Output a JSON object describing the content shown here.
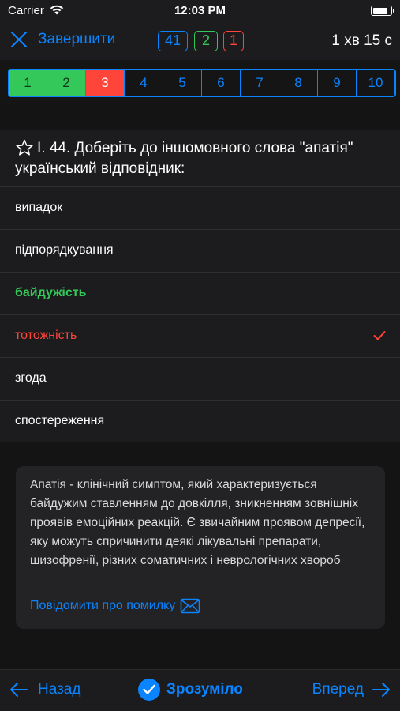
{
  "status_bar": {
    "carrier": "Carrier",
    "time": "12:03 PM",
    "battery_level": 0.85
  },
  "nav": {
    "finish_label": "Завершити",
    "counters": {
      "total": "41",
      "correct": "2",
      "wrong": "1"
    },
    "timer": "1 хв 15 с"
  },
  "question_strip": {
    "items": [
      {
        "label": "1",
        "state": "correct"
      },
      {
        "label": "2",
        "state": "correct"
      },
      {
        "label": "3",
        "state": "wrong"
      },
      {
        "label": "4",
        "state": "unanswered"
      },
      {
        "label": "5",
        "state": "unanswered"
      },
      {
        "label": "6",
        "state": "unanswered"
      },
      {
        "label": "7",
        "state": "unanswered"
      },
      {
        "label": "8",
        "state": "unanswered"
      },
      {
        "label": "9",
        "state": "unanswered"
      },
      {
        "label": "10",
        "state": "unanswered"
      }
    ]
  },
  "question": {
    "star_icon": "star-outline-icon",
    "text": "І. 44. Доберіть до іншомовного слова \"апатія\" український відповідник:"
  },
  "answers": [
    {
      "label": "випадок",
      "state": "normal"
    },
    {
      "label": "підпорядкування",
      "state": "normal"
    },
    {
      "label": "байдужість",
      "state": "correct"
    },
    {
      "label": "тотожність",
      "state": "chosen-wrong"
    },
    {
      "label": "згода",
      "state": "normal"
    },
    {
      "label": "спостереження",
      "state": "normal"
    }
  ],
  "explanation": {
    "text": "Апатія - клінічний симптом, який характеризується байдужим ставленням до довкілля, зникненням зовнішніх проявів емоційних реакцій. Є звичайним проявом депресії, яку можуть спричинити деякі лікувальні препарати, шизофренії, різних соматичних і неврологічних хвороб",
    "report_label": "Повідомити про помилку"
  },
  "bottom_bar": {
    "back_label": "Назад",
    "understood_label": "Зрозуміло",
    "forward_label": "Вперед"
  },
  "colors": {
    "accent": "#0a84ff",
    "correct": "#34c759",
    "wrong": "#ff453a",
    "background": "#1c1c1e"
  }
}
